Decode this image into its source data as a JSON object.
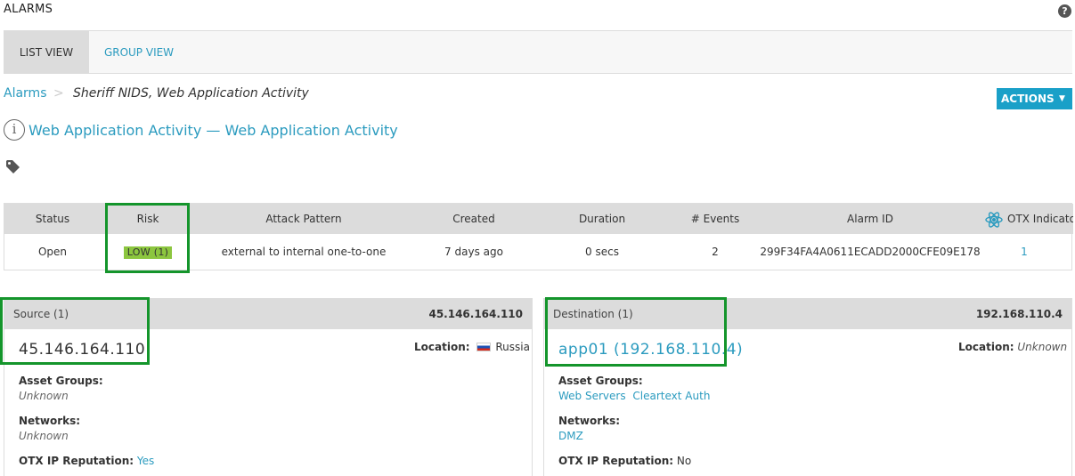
{
  "header": {
    "title": "ALARMS",
    "help_glyph": "?"
  },
  "tabs": [
    {
      "label": "LIST VIEW",
      "active": true
    },
    {
      "label": "GROUP VIEW",
      "active": false
    }
  ],
  "breadcrumb": {
    "root": "Alarms",
    "separator": ">",
    "current": "Sheriff NIDS, Web Application Activity"
  },
  "actions": {
    "label": "ACTIONS",
    "caret": "▼"
  },
  "alarm": {
    "title": "Web Application Activity — Web Application Activity",
    "info_glyph": "i"
  },
  "summary": {
    "columns": {
      "status": "Status",
      "risk": "Risk",
      "attack_pattern": "Attack Pattern",
      "created": "Created",
      "duration": "Duration",
      "events": "# Events",
      "alarm_id": "Alarm ID",
      "otx": "OTX Indicators"
    },
    "values": {
      "status": "Open",
      "risk": "LOW  (1)",
      "attack_pattern": "external to internal one-to-one",
      "created": "7 days ago",
      "duration": "0 secs",
      "events": "2",
      "alarm_id": "299F34FA4A0611ECADD2000CFE09E178",
      "otx": "1"
    }
  },
  "source": {
    "header_label": "Source (1)",
    "header_ip": "45.146.164.110",
    "ip": "45.146.164.110",
    "location_label": "Location:",
    "location_value": "Russia",
    "asset_groups_label": "Asset Groups:",
    "asset_groups_value": "Unknown",
    "networks_label": "Networks:",
    "networks_value": "Unknown",
    "otx_label": "OTX IP Reputation:",
    "otx_value": "Yes"
  },
  "destination": {
    "header_label": "Destination (1)",
    "header_ip": "192.168.110.4",
    "host": "app01 (192.168.110.4)",
    "location_label": "Location:",
    "location_value": "Unknown",
    "asset_groups_label": "Asset Groups:",
    "asset_groups": [
      "Web Servers",
      "Cleartext Auth"
    ],
    "networks_label": "Networks:",
    "networks_value": "DMZ",
    "otx_label": "OTX IP Reputation:",
    "otx_value": "No"
  },
  "colors": {
    "accent": "#2b9bbf",
    "actions_bg": "#1aa0c8",
    "risk_low": "#8cc63f",
    "highlight": "#14952b"
  }
}
